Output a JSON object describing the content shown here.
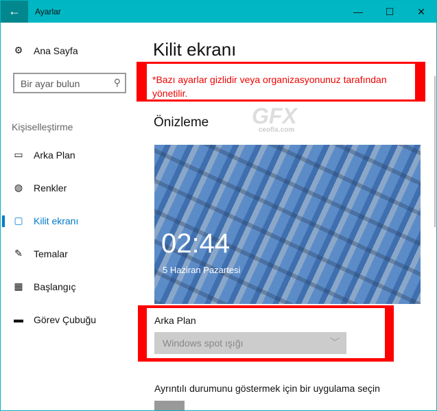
{
  "window": {
    "title": "Ayarlar",
    "back_icon": "arrow-left",
    "minimize": "—",
    "maximize": "☐",
    "close": "✕",
    "accent": "#00b7c3"
  },
  "sidebar": {
    "home": "Ana Sayfa",
    "search_placeholder": "Bir ayar bulun",
    "section": "Kişiselleştirme",
    "items": [
      {
        "label": "Arka Plan",
        "icon": "image-icon"
      },
      {
        "label": "Renkler",
        "icon": "palette-icon"
      },
      {
        "label": "Kilit ekranı",
        "icon": "lock-screen-icon",
        "selected": true
      },
      {
        "label": "Temalar",
        "icon": "theme-icon"
      },
      {
        "label": "Başlangıç",
        "icon": "start-icon"
      },
      {
        "label": "Görev Çubuğu",
        "icon": "taskbar-icon"
      }
    ]
  },
  "main": {
    "title": "Kilit ekranı",
    "warning": "*Bazı ayarlar gizlidir veya organizasyonunuz tarafından yönetilir.",
    "preview_heading": "Önizleme",
    "watermark": "GFX",
    "watermark_sub": "ceofix.com",
    "clock": "02:44",
    "date": "5 Haziran Pazartesi",
    "background_label": "Arka Plan",
    "background_value": "Windows spot ışığı",
    "detail_label": "Ayrıntılı durumunu göstermek için bir uygulama seçin"
  }
}
